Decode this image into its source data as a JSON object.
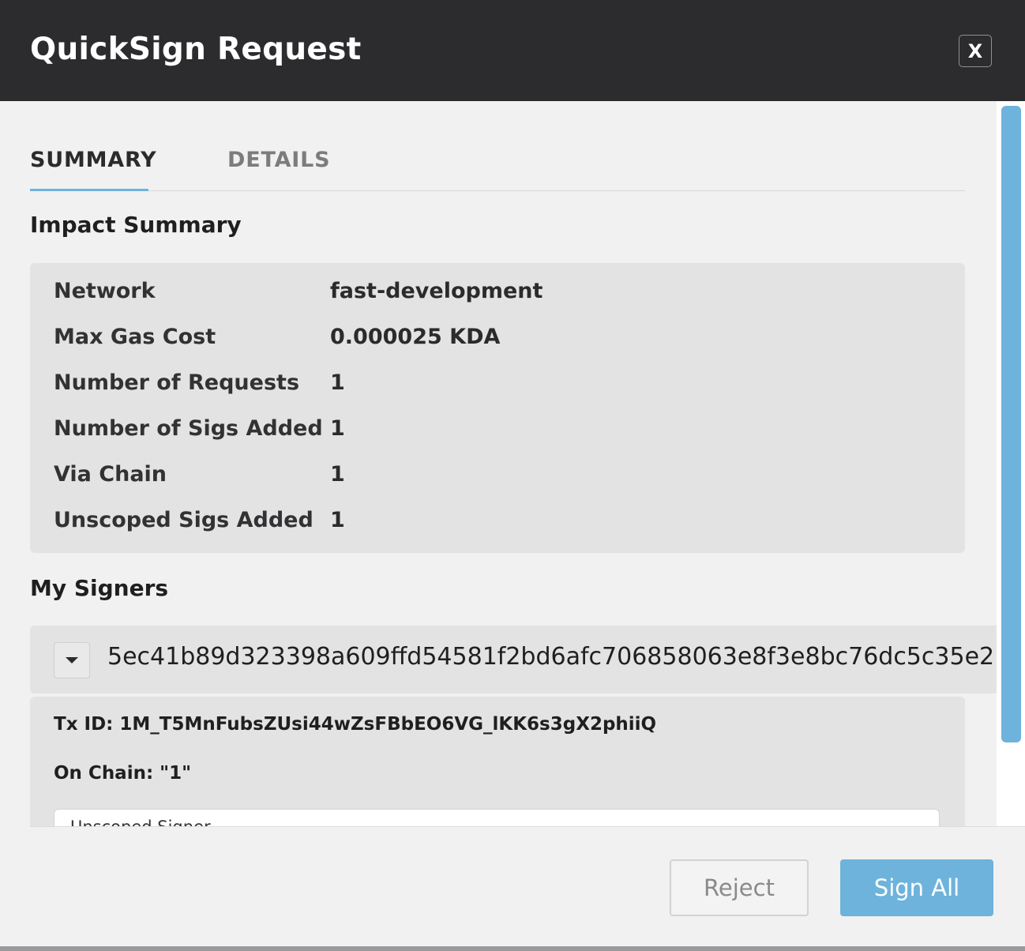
{
  "header": {
    "title": "QuickSign Request",
    "close_label": "X"
  },
  "tabs": [
    {
      "label": "SUMMARY",
      "active": true
    },
    {
      "label": "DETAILS",
      "active": false
    }
  ],
  "impact_summary": {
    "title": "Impact Summary",
    "rows": [
      {
        "label": "Network",
        "value": "fast-development"
      },
      {
        "label": "Max Gas Cost",
        "value": "0.000025 KDA"
      },
      {
        "label": "Number of Requests",
        "value": "1"
      },
      {
        "label": "Number of Sigs Added",
        "value": "1"
      },
      {
        "label": "Via Chain",
        "value": "1"
      },
      {
        "label": "Unscoped Sigs Added",
        "value": "1"
      }
    ]
  },
  "signers": {
    "title": "My Signers",
    "items": [
      {
        "public_key": "5ec41b89d323398a609ffd54581f2bd6afc706858063e8f3e8bc76dc5c35e2",
        "tx_id_line": "Tx ID: 1M_T5MnFubsZUsi44wZsFBbEO6VG_lKK6s3gX2phiiQ",
        "chain_line": "On Chain: \"1\"",
        "unscoped_label": "Unscoped Signer"
      }
    ]
  },
  "footer": {
    "reject_label": "Reject",
    "sign_all_label": "Sign All"
  },
  "colors": {
    "accent": "#6eb3dc",
    "header_bg": "#2c2c2e",
    "panel_bg": "#e3e3e3"
  }
}
